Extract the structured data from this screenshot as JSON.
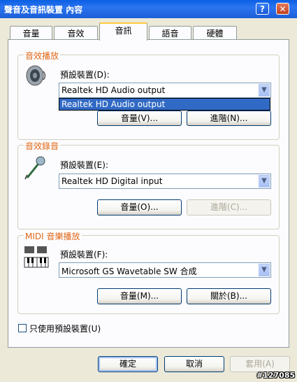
{
  "window": {
    "title": "聲音及音訊裝置 內容",
    "help_symbol": "?",
    "close_symbol": "✕"
  },
  "tabs": [
    {
      "label": "音量"
    },
    {
      "label": "音效"
    },
    {
      "label": "音訊",
      "selected": true
    },
    {
      "label": "語音"
    },
    {
      "label": "硬體"
    }
  ],
  "playback": {
    "title": "音效播放",
    "device_label": "預設裝置(D):",
    "device_value": "Realtek HD Audio output",
    "dropdown_open": true,
    "dropdown_options": [
      "Realtek HD Audio output"
    ],
    "volume_button": "音量(V)...",
    "advanced_button": "進階(N)...",
    "icon": "speaker-icon"
  },
  "recording": {
    "title": "音效錄音",
    "device_label": "預設裝置(E):",
    "device_value": "Realtek HD Digital input",
    "volume_button": "音量(O)...",
    "advanced_button": "進階(C)...",
    "advanced_disabled": true,
    "icon": "microphone-icon"
  },
  "midi": {
    "title": "MIDI 音樂播放",
    "device_label": "預設裝置(F):",
    "device_value": "Microsoft GS Wavetable SW 合成",
    "volume_button": "音量(M)...",
    "about_button": "關於(B)...",
    "icon": "midi-keyboard-icon"
  },
  "use_default_only": {
    "label": "只使用預設裝置(U)",
    "checked": false
  },
  "footer": {
    "ok": "確定",
    "cancel": "取消",
    "apply": "套用(A)",
    "apply_disabled": true
  },
  "watermark": "#127085",
  "colors": {
    "titlebar": "#0a5fe3",
    "group_title": "#e06818",
    "selection": "#316ac5"
  }
}
